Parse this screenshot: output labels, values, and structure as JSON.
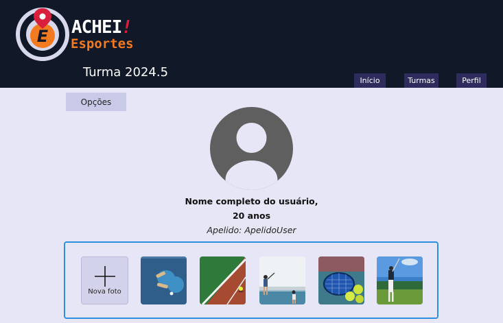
{
  "brand": {
    "name_main": "ACHEI",
    "name_bang": "!",
    "name_sub": "Esportes",
    "logo_letter": "E"
  },
  "header": {
    "class_title": "Turma 2024.5"
  },
  "nav": {
    "inicio": "Início",
    "turmas": "Turmas",
    "perfil": "Perfil"
  },
  "options_button": "Opções",
  "profile": {
    "full_name": "Nome completo do usuário,",
    "age": "20 anos",
    "nickname": "Apelido: ApelidoUser"
  },
  "gallery": {
    "add_photo_label": "Nova foto",
    "photos": [
      {
        "icon": "ping-pong-paddles-photo"
      },
      {
        "icon": "tennis-court-ball-photo"
      },
      {
        "icon": "tennis-players-photo"
      },
      {
        "icon": "tennis-racket-balls-photo"
      },
      {
        "icon": "golfer-photo"
      }
    ]
  },
  "colors": {
    "header_bg": "#111827",
    "page_bg": "#e6e6f6",
    "nav_bg": "#2e2c5c",
    "accent_orange": "#f47a20",
    "accent_red": "#d91f3b",
    "gallery_border": "#2d8fe0"
  }
}
